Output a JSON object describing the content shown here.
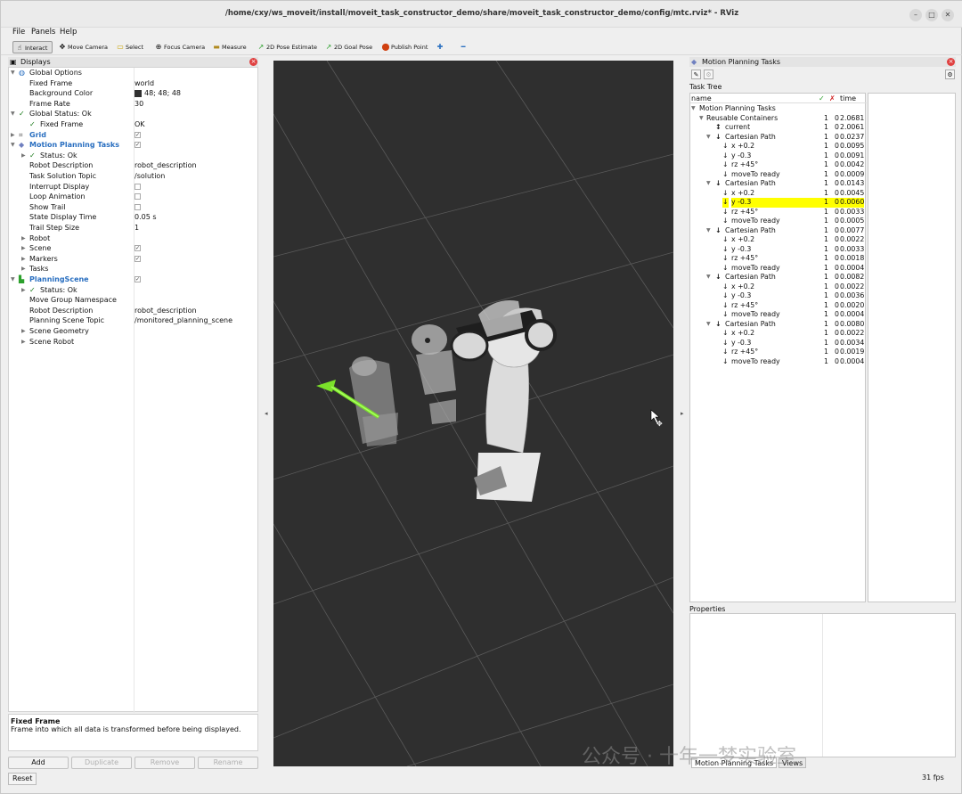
{
  "window": {
    "title": "/home/cxy/ws_moveit/install/moveit_task_constructor_demo/share/moveit_task_constructor_demo/config/mtc.rviz* - RViz",
    "controls": [
      "–",
      "□",
      "✕"
    ]
  },
  "menu": {
    "file": "File",
    "panels": "Panels",
    "help": "Help"
  },
  "toolbar": {
    "interact": "Interact",
    "move_camera": "Move Camera",
    "select": "Select",
    "focus_camera": "Focus Camera",
    "measure": "Measure",
    "pose_estimate": "2D Pose Estimate",
    "goal_pose": "2D Goal Pose",
    "publish_point": "Publish Point"
  },
  "displays": {
    "title": "Displays",
    "rows": [
      {
        "name": "Global Options",
        "value": ""
      },
      {
        "name": "Fixed Frame",
        "value": "world"
      },
      {
        "name": "Background Color",
        "value": "48; 48; 48"
      },
      {
        "name": "Frame Rate",
        "value": "30"
      },
      {
        "name": "Global Status: Ok",
        "value": ""
      },
      {
        "name": "Fixed Frame",
        "value": "OK"
      },
      {
        "name": "Grid",
        "value": ""
      },
      {
        "name": "Motion Planning Tasks",
        "value": ""
      },
      {
        "name": "Status: Ok",
        "value": ""
      },
      {
        "name": "Robot Description",
        "value": "robot_description"
      },
      {
        "name": "Task Solution Topic",
        "value": "/solution"
      },
      {
        "name": "Interrupt Display",
        "value": ""
      },
      {
        "name": "Loop Animation",
        "value": ""
      },
      {
        "name": "Show Trail",
        "value": ""
      },
      {
        "name": "State Display Time",
        "value": "0.05 s"
      },
      {
        "name": "Trail Step Size",
        "value": "1"
      },
      {
        "name": "Robot",
        "value": ""
      },
      {
        "name": "Scene",
        "value": ""
      },
      {
        "name": "Markers",
        "value": ""
      },
      {
        "name": "Tasks",
        "value": ""
      },
      {
        "name": "PlanningScene",
        "value": ""
      },
      {
        "name": "Status: Ok",
        "value": ""
      },
      {
        "name": "Move Group Namespace",
        "value": ""
      },
      {
        "name": "Robot Description",
        "value": "robot_description"
      },
      {
        "name": "Planning Scene Topic",
        "value": "/monitored_planning_scene"
      },
      {
        "name": "Scene Geometry",
        "value": ""
      },
      {
        "name": "Scene Robot",
        "value": ""
      }
    ],
    "description_title": "Fixed Frame",
    "description_text": "Frame into which all data is transformed before being displayed.",
    "buttons": {
      "add": "Add",
      "duplicate": "Duplicate",
      "remove": "Remove",
      "rename": "Rename"
    }
  },
  "mpt": {
    "title": "Motion Planning Tasks",
    "task_tree_label": "Task Tree",
    "columns": {
      "name": "name",
      "success": "✓",
      "fail": "✗",
      "time": "time"
    },
    "rows": [
      {
        "name": "Motion Planning Tasks",
        "s": "",
        "f": "",
        "t": ""
      },
      {
        "name": "Reusable Containers",
        "s": "1",
        "f": "0",
        "t": "2.0681"
      },
      {
        "name": "current",
        "s": "1",
        "f": "0",
        "t": "2.0061"
      },
      {
        "name": "Cartesian Path",
        "s": "1",
        "f": "0",
        "t": "0.0237"
      },
      {
        "name": "x +0.2",
        "s": "1",
        "f": "0",
        "t": "0.0095"
      },
      {
        "name": "y -0.3",
        "s": "1",
        "f": "0",
        "t": "0.0091"
      },
      {
        "name": "rz +45°",
        "s": "1",
        "f": "0",
        "t": "0.0042"
      },
      {
        "name": "moveTo ready",
        "s": "1",
        "f": "0",
        "t": "0.0009"
      },
      {
        "name": "Cartesian Path",
        "s": "1",
        "f": "0",
        "t": "0.0143"
      },
      {
        "name": "x +0.2",
        "s": "1",
        "f": "0",
        "t": "0.0045"
      },
      {
        "name": "y -0.3",
        "s": "1",
        "f": "0",
        "t": "0.0060"
      },
      {
        "name": "rz +45°",
        "s": "1",
        "f": "0",
        "t": "0.0033"
      },
      {
        "name": "moveTo ready",
        "s": "1",
        "f": "0",
        "t": "0.0005"
      },
      {
        "name": "Cartesian Path",
        "s": "1",
        "f": "0",
        "t": "0.0077"
      },
      {
        "name": "x +0.2",
        "s": "1",
        "f": "0",
        "t": "0.0022"
      },
      {
        "name": "y -0.3",
        "s": "1",
        "f": "0",
        "t": "0.0033"
      },
      {
        "name": "rz +45°",
        "s": "1",
        "f": "0",
        "t": "0.0018"
      },
      {
        "name": "moveTo ready",
        "s": "1",
        "f": "0",
        "t": "0.0004"
      },
      {
        "name": "Cartesian Path",
        "s": "1",
        "f": "0",
        "t": "0.0082"
      },
      {
        "name": "x +0.2",
        "s": "1",
        "f": "0",
        "t": "0.0022"
      },
      {
        "name": "y -0.3",
        "s": "1",
        "f": "0",
        "t": "0.0036"
      },
      {
        "name": "rz +45°",
        "s": "1",
        "f": "0",
        "t": "0.0020"
      },
      {
        "name": "moveTo ready",
        "s": "1",
        "f": "0",
        "t": "0.0004"
      },
      {
        "name": "Cartesian Path",
        "s": "1",
        "f": "0",
        "t": "0.0080"
      },
      {
        "name": "x +0.2",
        "s": "1",
        "f": "0",
        "t": "0.0022"
      },
      {
        "name": "y -0.3",
        "s": "1",
        "f": "0",
        "t": "0.0034"
      },
      {
        "name": "rz +45°",
        "s": "1",
        "f": "0",
        "t": "0.0019"
      },
      {
        "name": "moveTo ready",
        "s": "1",
        "f": "0",
        "t": "0.0004"
      }
    ],
    "properties_label": "Properties",
    "tabs": {
      "mpt": "Motion Planning Tasks",
      "views": "Views"
    }
  },
  "watermark": "公众号 · 十年一梦实验室",
  "status": {
    "reset": "Reset",
    "fps": "31 fps"
  },
  "colors": {
    "background": "#303030",
    "highlight": "#ffff00",
    "accent": "#2a6fc0",
    "goal_arrow": "#7be02a"
  }
}
